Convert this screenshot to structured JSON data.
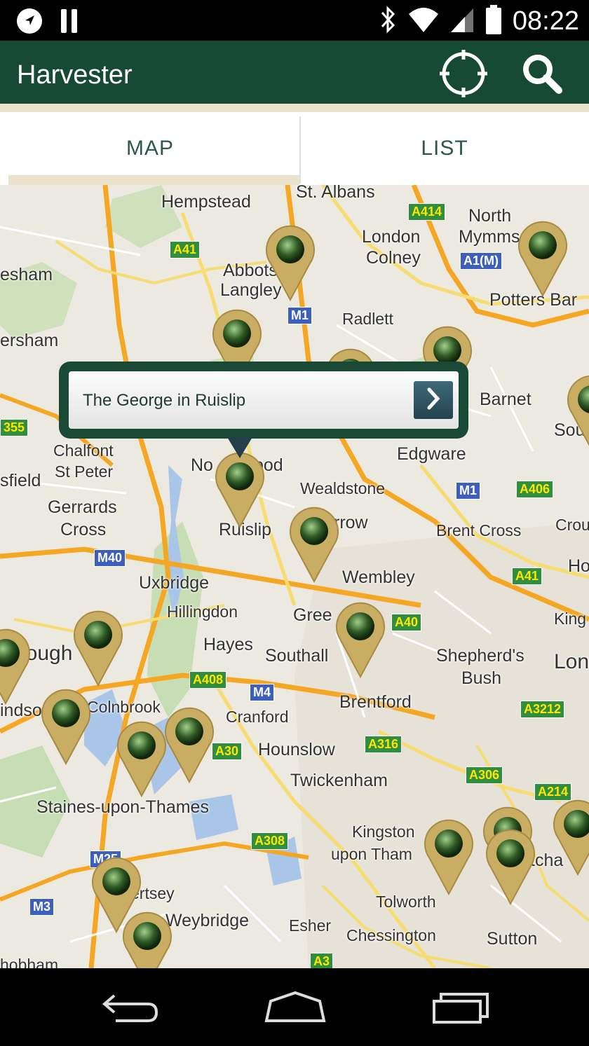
{
  "status_bar": {
    "time": "08:22",
    "left_icons": [
      "navigation-icon",
      "pause-icon"
    ],
    "right_icons": [
      "bluetooth-icon",
      "wifi-icon",
      "signal-icon",
      "battery-icon"
    ]
  },
  "app_bar": {
    "title": "Harvester",
    "actions": [
      "locate-icon",
      "search-icon"
    ],
    "color": "#174a35"
  },
  "tabs": [
    {
      "label": "MAP",
      "selected": true
    },
    {
      "label": "LIST",
      "selected": false
    }
  ],
  "map": {
    "places": [
      "Hempstead",
      "St. Albans",
      "North",
      "Mymms",
      "London",
      "Colney",
      "esham",
      "Abbots",
      "Langley",
      "Potters Bar",
      "Radlett",
      "ersham",
      "Barnet",
      "Sou",
      "Chalfont",
      "St Peter",
      "Edgware",
      "Wealdstone",
      "sfield",
      "No",
      "ood",
      "Gerrards",
      "Cross",
      "Ruislip",
      "rrow",
      "Brent Cross",
      "Crou",
      "Ho",
      "Uxbridge",
      "Wembley",
      "Hillingdon",
      "Gree",
      "King",
      "Slough",
      "Hayes",
      "Southall",
      "Shepherd's",
      "Bush",
      "Lon",
      "Brentford",
      "Colnbrook",
      "indso",
      "Cranford",
      "Hounslow",
      "Twickenham",
      "Staines-upon-Thames",
      "Kingston",
      "upon Tham",
      "tcha",
      "ertsey",
      "Weybridge",
      "Tolworth",
      "Esher",
      "Chessington",
      "Sutton",
      "hobham"
    ],
    "roads": [
      "A414",
      "A41",
      "A1(M)",
      "M1",
      "355",
      "A406",
      "M1",
      "A41",
      "M40",
      "A40",
      "A408",
      "M4",
      "A3212",
      "A30",
      "A316",
      "A306",
      "A214",
      "A308",
      "M25",
      "M3",
      "A3"
    ],
    "info_window": {
      "title": "The George in Ruislip",
      "action": "chevron-right-icon"
    },
    "pin_color": "#c9ad63"
  },
  "nav_bar": {
    "buttons": [
      "back-icon",
      "home-icon",
      "recents-icon"
    ]
  }
}
